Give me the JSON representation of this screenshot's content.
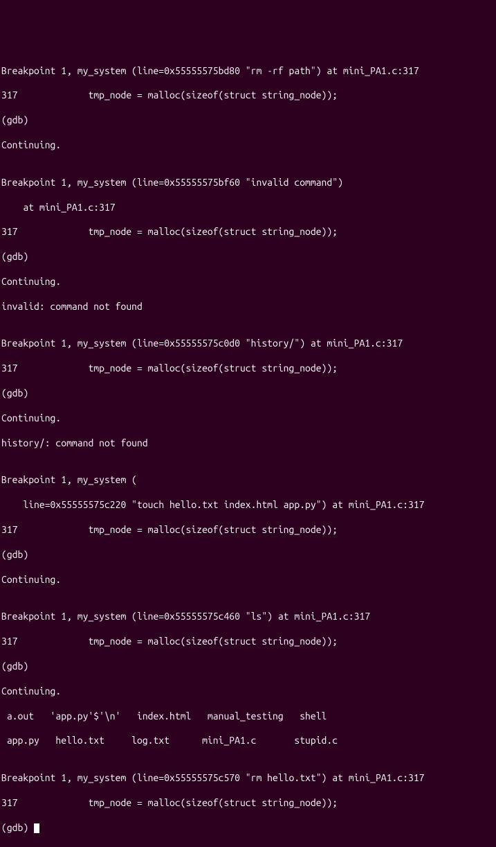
{
  "terminal": {
    "lines": [
      "Breakpoint 1, my_system (line=0x55555575bd80 \"rm -rf path\") at mini_PA1.c:317",
      "317             tmp_node = malloc(sizeof(struct string_node));",
      "(gdb) ",
      "Continuing.",
      "",
      "Breakpoint 1, my_system (line=0x55555575bf60 \"invalid command\")",
      "    at mini_PA1.c:317",
      "317             tmp_node = malloc(sizeof(struct string_node));",
      "(gdb) ",
      "Continuing.",
      "invalid: command not found",
      "",
      "Breakpoint 1, my_system (line=0x55555575c0d0 \"history/\") at mini_PA1.c:317",
      "317             tmp_node = malloc(sizeof(struct string_node));",
      "(gdb) ",
      "Continuing.",
      "history/: command not found",
      "",
      "Breakpoint 1, my_system (",
      "    line=0x55555575c220 \"touch hello.txt index.html app.py\") at mini_PA1.c:317",
      "317             tmp_node = malloc(sizeof(struct string_node));",
      "(gdb) ",
      "Continuing.",
      "",
      "Breakpoint 1, my_system (line=0x55555575c460 \"ls\") at mini_PA1.c:317",
      "317             tmp_node = malloc(sizeof(struct string_node));",
      "(gdb) ",
      "Continuing.",
      " a.out   'app.py'$'\\n'   index.html   manual_testing   shell",
      " app.py   hello.txt     log.txt      mini_PA1.c       stupid.c",
      "",
      "Breakpoint 1, my_system (line=0x55555575c570 \"rm hello.txt\") at mini_PA1.c:317",
      "317             tmp_node = malloc(sizeof(struct string_node));"
    ],
    "prompt": "(gdb) "
  }
}
